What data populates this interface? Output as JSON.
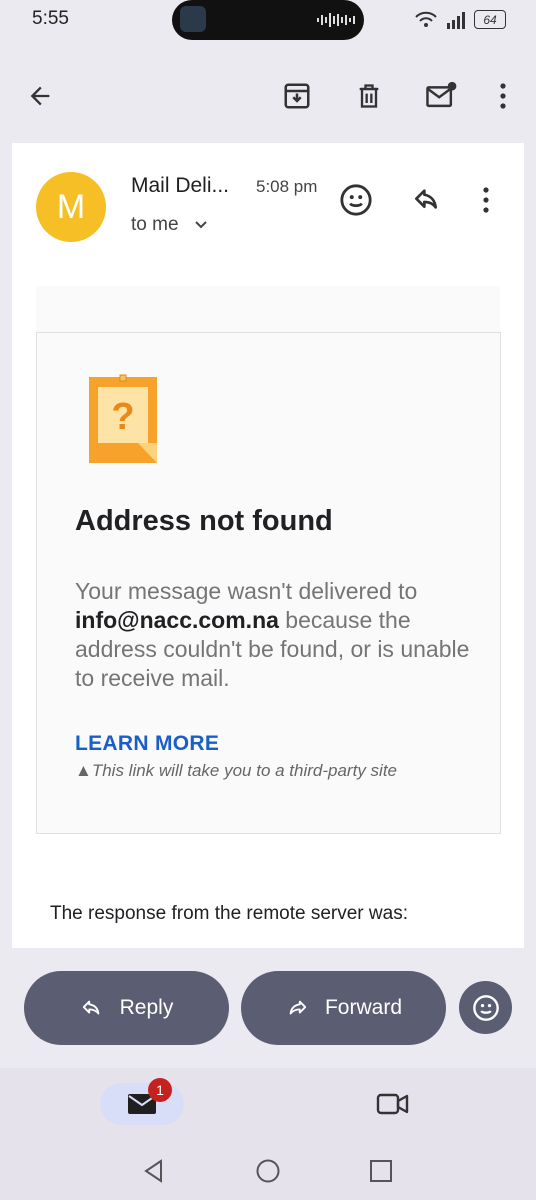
{
  "status_bar": {
    "time": "5:55",
    "battery": "64"
  },
  "email": {
    "avatar_letter": "M",
    "sender": "Mail Deli...",
    "time": "5:08 pm",
    "recipient": "to me"
  },
  "bounce": {
    "title": "Address not found",
    "message_before": "Your message wasn't delivered to ",
    "address": "info@nacc.com.na",
    "message_after": " because the address couldn't be found, or is unable to receive mail.",
    "learn_more": "LEARN MORE",
    "warning_note": "This link will take you to a third-party site",
    "remote_response": "The response from the remote server was:"
  },
  "actions": {
    "reply": "Reply",
    "forward": "Forward"
  },
  "bottom_nav": {
    "mail_badge": "1"
  }
}
